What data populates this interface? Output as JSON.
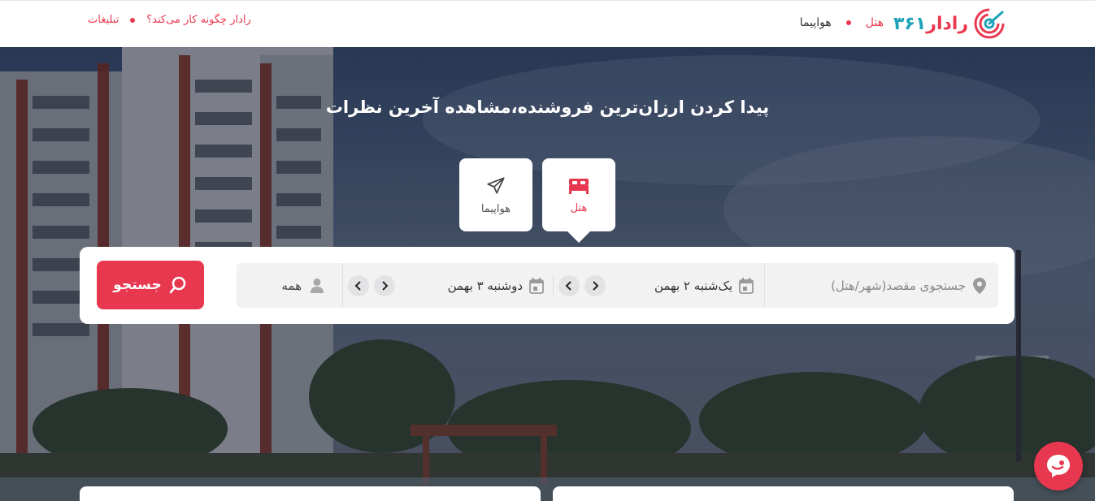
{
  "header": {
    "brand_word": "رادار",
    "brand_number": "۳۶۱",
    "main_nav": [
      {
        "label": "هتل",
        "active": true
      },
      {
        "label": "هواپیما",
        "active": false
      }
    ],
    "secondary_nav": [
      "رادار چگونه کار می‌کند؟",
      "تبلیغات"
    ]
  },
  "hero": {
    "headline": "پیدا کردن ارزان‌ترین فروشنده،مشاهده آخرین نظرات"
  },
  "tabs": [
    {
      "label": "هتل",
      "icon": "bed-icon",
      "active": true
    },
    {
      "label": "هواپیما",
      "icon": "airplane-icon",
      "active": false
    }
  ],
  "search": {
    "destination_placeholder": "جستجوی مقصد(شهر/هتل)",
    "checkin_date": "یک‌شنبه ۲ بهمن",
    "checkout_date": "دوشنبه ۳ بهمن",
    "guests": "همه",
    "button_label": "جستجو"
  },
  "colors": {
    "accent": "#e8384f",
    "brand_teal": "#1ea2b8"
  }
}
